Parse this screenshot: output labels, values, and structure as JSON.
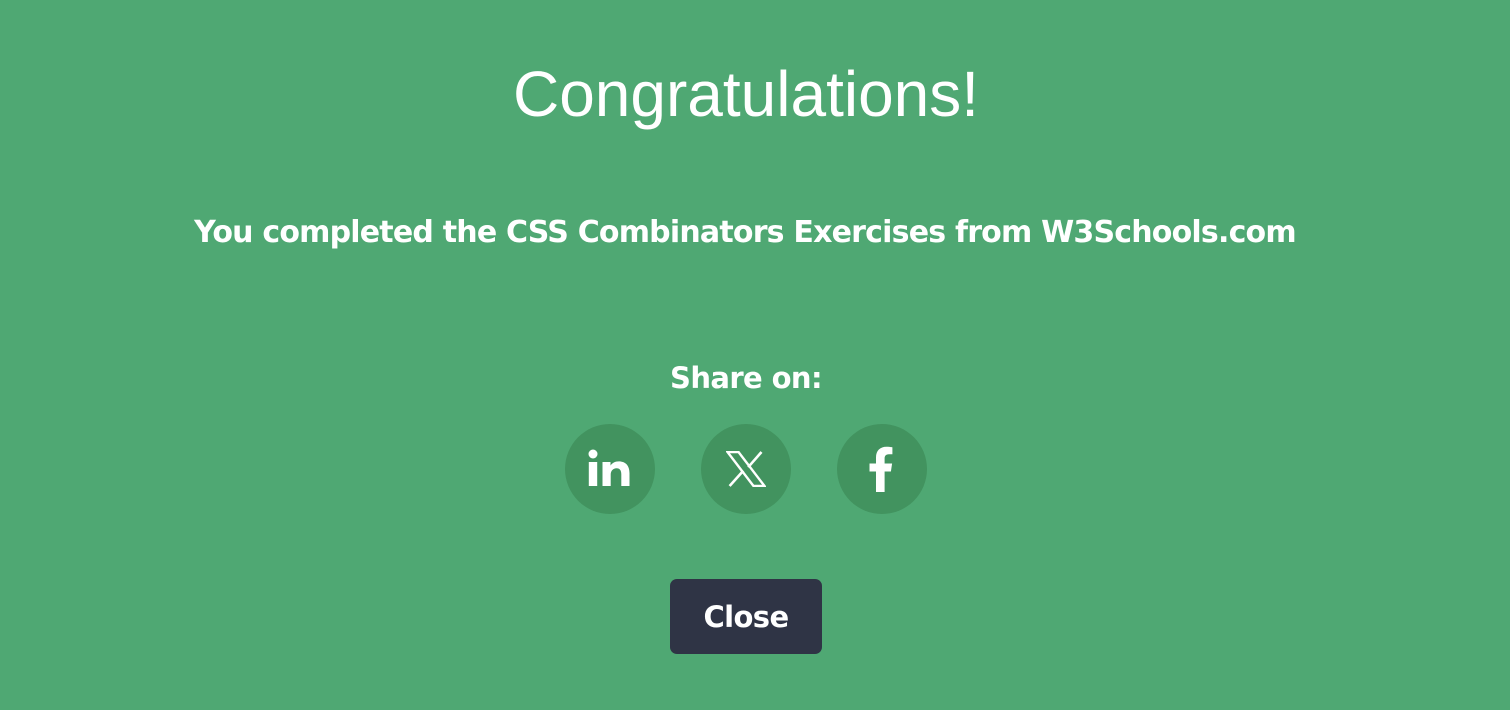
{
  "dialog": {
    "title": "Congratulations!",
    "message": "You completed the CSS Combinators Exercises from W3Schools.com",
    "share_label": "Share on:",
    "share_buttons": [
      {
        "network": "LinkedIn",
        "icon": "linkedin-icon"
      },
      {
        "network": "X",
        "icon": "x-icon"
      },
      {
        "network": "Facebook",
        "icon": "facebook-icon"
      }
    ],
    "close_label": "Close"
  },
  "colors": {
    "background": "#4fa873",
    "share_button_bg": "#42935f",
    "close_button_bg": "#2f3445",
    "text": "#ffffff"
  }
}
